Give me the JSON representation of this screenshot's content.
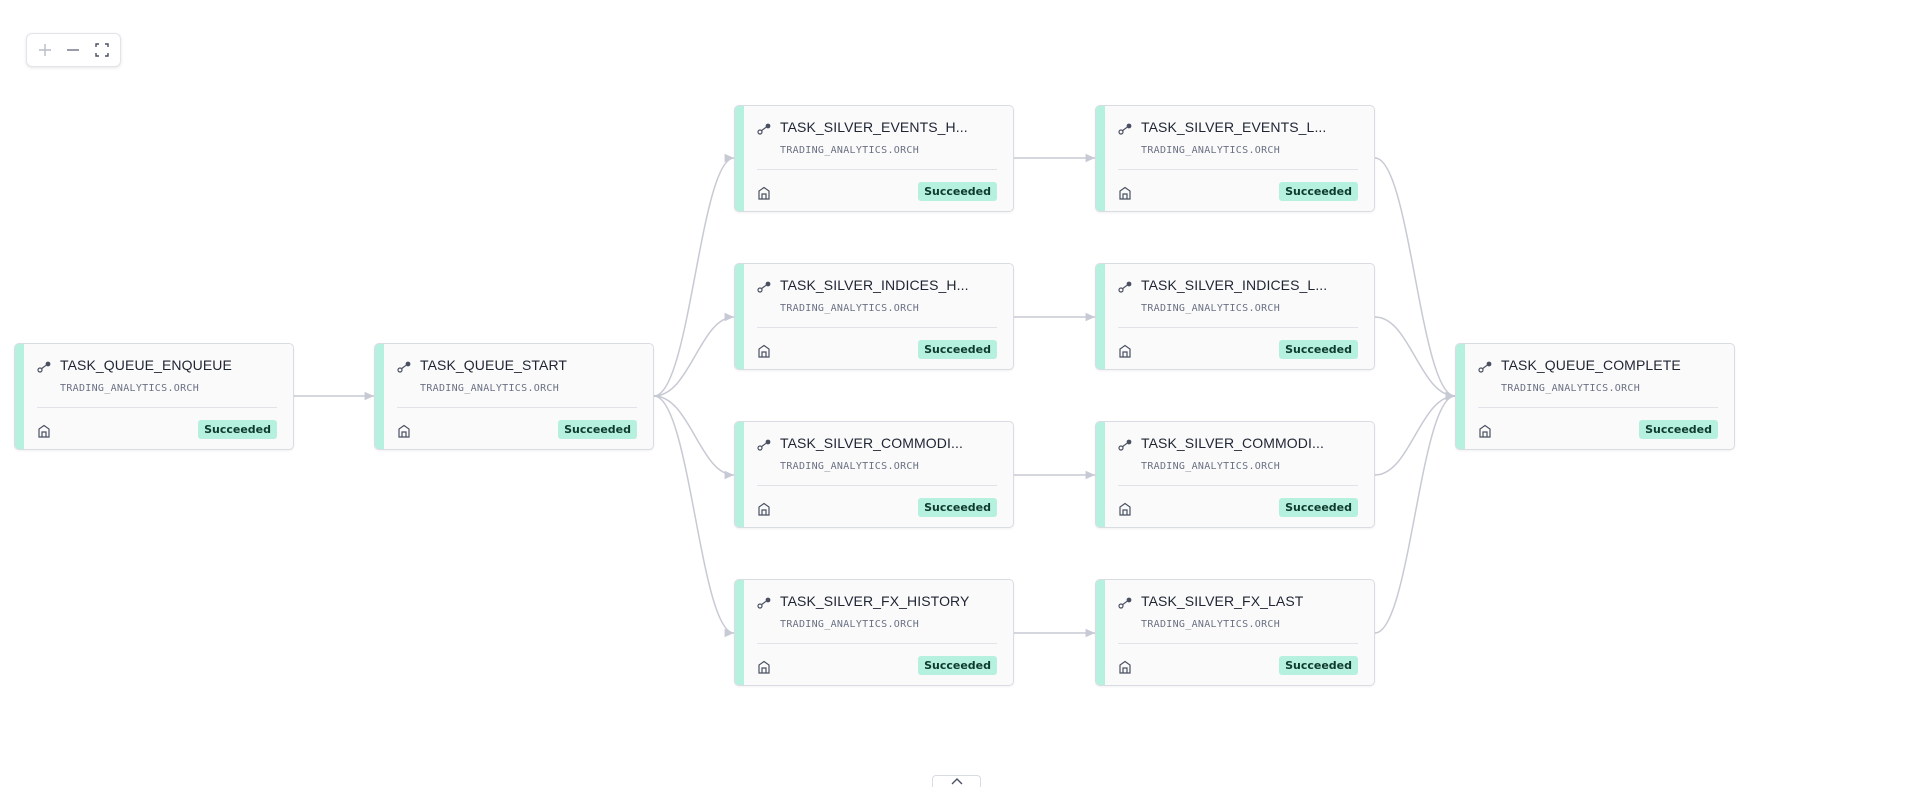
{
  "zoom_controls": {
    "zoom_in_icon": "plus-icon",
    "zoom_out_icon": "minus-icon",
    "fit_icon": "fit-screen-icon"
  },
  "colors": {
    "accent": "#b6f0de",
    "status_text": "#0e3a2c",
    "edge": "#c7cad4"
  },
  "nodes": [
    {
      "name": "TASK_QUEUE_ENQUEUE",
      "schema": "TRADING_ANALYTICS.ORCH",
      "status": "Succeeded"
    },
    {
      "name": "TASK_QUEUE_START",
      "schema": "TRADING_ANALYTICS.ORCH",
      "status": "Succeeded"
    },
    {
      "name": "TASK_SILVER_EVENTS_H...",
      "schema": "TRADING_ANALYTICS.ORCH",
      "status": "Succeeded"
    },
    {
      "name": "TASK_SILVER_INDICES_H...",
      "schema": "TRADING_ANALYTICS.ORCH",
      "status": "Succeeded"
    },
    {
      "name": "TASK_SILVER_COMMODI...",
      "schema": "TRADING_ANALYTICS.ORCH",
      "status": "Succeeded"
    },
    {
      "name": "TASK_SILVER_FX_HISTORY",
      "schema": "TRADING_ANALYTICS.ORCH",
      "status": "Succeeded"
    },
    {
      "name": "TASK_SILVER_EVENTS_L...",
      "schema": "TRADING_ANALYTICS.ORCH",
      "status": "Succeeded"
    },
    {
      "name": "TASK_SILVER_INDICES_L...",
      "schema": "TRADING_ANALYTICS.ORCH",
      "status": "Succeeded"
    },
    {
      "name": "TASK_SILVER_COMMODI...",
      "schema": "TRADING_ANALYTICS.ORCH",
      "status": "Succeeded"
    },
    {
      "name": "TASK_SILVER_FX_LAST",
      "schema": "TRADING_ANALYTICS.ORCH",
      "status": "Succeeded"
    },
    {
      "name": "TASK_QUEUE_COMPLETE",
      "schema": "TRADING_ANALYTICS.ORCH",
      "status": "Succeeded"
    }
  ],
  "bottom_panel": {
    "toggle_icon": "chevron-up-icon"
  }
}
